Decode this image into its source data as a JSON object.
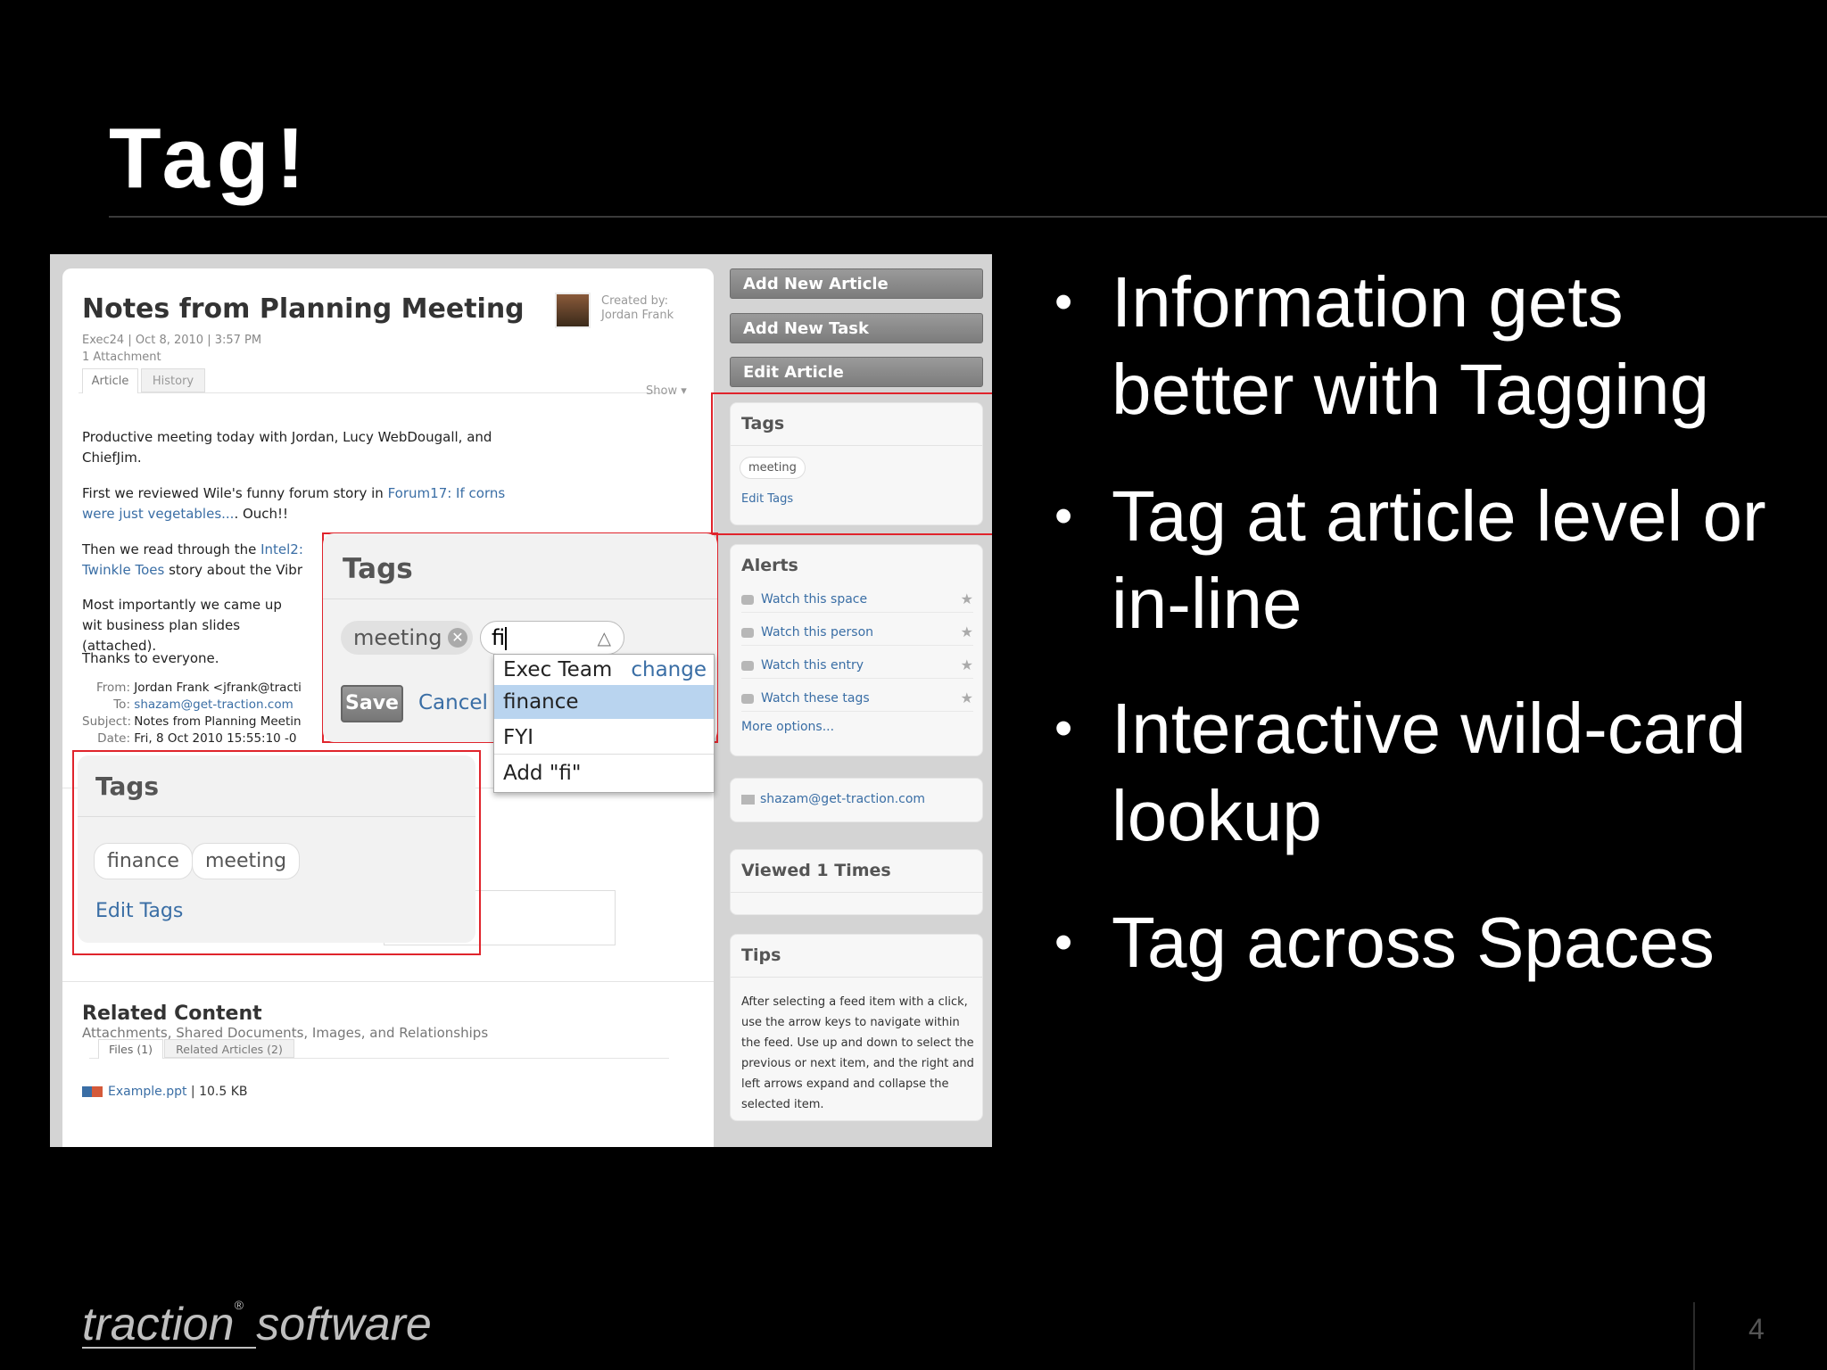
{
  "slide": {
    "title": "Tag!"
  },
  "article": {
    "title": "Notes from Planning Meeting",
    "meta": "Exec24 | Oct 8, 2010 | 3:57 PM",
    "attachments": "1 Attachment",
    "created_by_label": "Created by:",
    "created_by_name": "Jordan Frank",
    "tabs": [
      "Article",
      "History"
    ],
    "show_label": "Show",
    "body": {
      "0": "Productive meeting today with Jordan, Lucy WebDougall, and ChiefJim.",
      "1a": "First we reviewed Wile's funny forum story in ",
      "1link": "Forum17: If corns were just vegetables...",
      "1b": ". Ouch!!",
      "2a": "Then we read through the ",
      "2link": "Intel2: Twinkle Toes",
      "2b": " story about the Vibr",
      "3": "Most importantly we came up wit business plan slides (attached).",
      "4": "Thanks to everyone."
    }
  },
  "email": {
    "from_label": "From:",
    "from": "Jordan Frank <jfrank@tracti",
    "to_label": "To:",
    "to": "shazam@get-traction.com",
    "subject_label": "Subject:",
    "subject": "Notes from Planning Meetin",
    "date_label": "Date:",
    "date": "Fri, 8 Oct 2010 15:55:10 -0"
  },
  "related": {
    "title": "Related Content",
    "subtitle": "Attachments, Shared Documents, Images, and Relationships",
    "tabs": [
      "Files (1)",
      "Related Articles (2)"
    ],
    "file_name": "Example.ppt",
    "file_size": "| 10.5 KB"
  },
  "sidebar": {
    "buttons": [
      "Add New Article",
      "Add New Task",
      "Edit Article"
    ],
    "tags_title": "Tags",
    "tags": [
      "meeting"
    ],
    "edit_tags": "Edit Tags",
    "alerts_title": "Alerts",
    "alerts": [
      "Watch this space",
      "Watch this person",
      "Watch this entry",
      "Watch these tags"
    ],
    "more_options": "More options...",
    "email": "shazam@get-traction.com",
    "viewed": "Viewed 1 Times",
    "tips_title": "Tips",
    "tips_text": "After selecting a feed item with a click, use the arrow keys to navigate within the feed. Use up and down to select the previous or next item, and the right and left arrows expand and collapse the selected item."
  },
  "tag_editor": {
    "title": "Tags",
    "chips": [
      "meeting"
    ],
    "input_value": "fi",
    "save": "Save",
    "cancel": "Cancel"
  },
  "dropdown": {
    "space": "Exec Team",
    "change": "change",
    "options": [
      "finance",
      "FYI",
      "Add \"fi\""
    ]
  },
  "article_tags": {
    "title": "Tags",
    "tags": [
      "finance",
      "meeting"
    ],
    "edit": "Edit Tags"
  },
  "bullets": [
    "Information gets better with Tagging",
    "Tag at article level or in-line",
    "Interactive wild-card lookup",
    "Tag across Spaces"
  ],
  "footer": {
    "logo_a": "traction",
    "logo_reg": "®",
    "logo_b": " software",
    "page": "4"
  },
  "colors": {
    "accent_red": "#e0242c",
    "link_blue": "#3a6ea5",
    "highlight": "#b9d4ef"
  }
}
